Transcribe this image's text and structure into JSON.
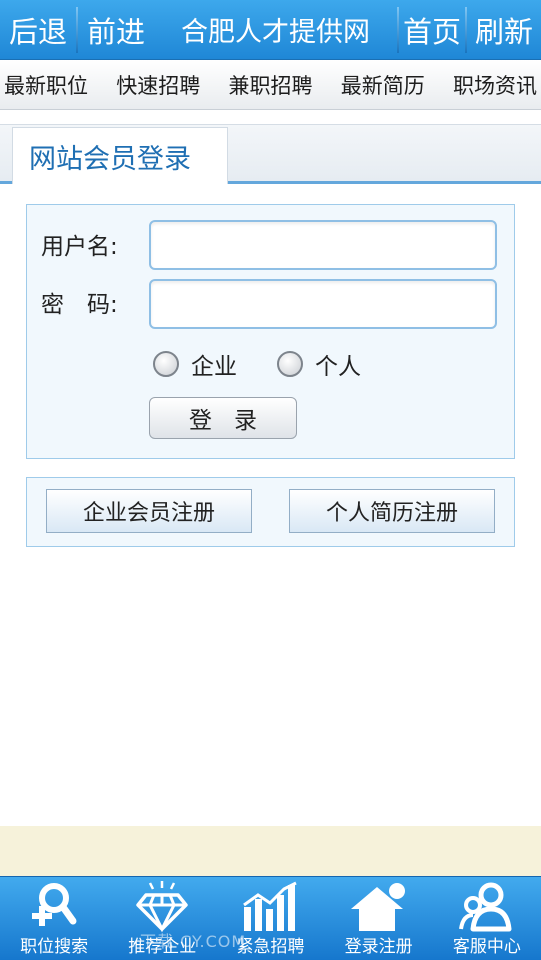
{
  "topbar": {
    "back_label": "后退",
    "forward_label": "前进",
    "title": "合肥人才提供网",
    "home_label": "首页",
    "refresh_label": "刷新"
  },
  "nav": {
    "items": [
      {
        "label": "最新职位"
      },
      {
        "label": "快速招聘"
      },
      {
        "label": "兼职招聘"
      },
      {
        "label": "最新简历"
      },
      {
        "label": "职场资讯"
      }
    ]
  },
  "tab": {
    "label": "网站会员登录"
  },
  "login": {
    "username_label": "用户名:",
    "password_label": "密　码:",
    "username_value": "",
    "password_value": "",
    "radio_enterprise": "企业",
    "radio_personal": "个人",
    "submit_label": "登录"
  },
  "register": {
    "enterprise_label": "企业会员注册",
    "personal_label": "个人简历注册"
  },
  "bottom": {
    "items": [
      {
        "label": "职位搜索",
        "icon": "person-search-icon"
      },
      {
        "label": "推荐企业",
        "icon": "diamond-icon"
      },
      {
        "label": "紧急招聘",
        "icon": "bar-chart-icon"
      },
      {
        "label": "登录注册",
        "icon": "house-icon"
      },
      {
        "label": "客服中心",
        "icon": "people-icon"
      }
    ],
    "watermark": "下载 CY.COM"
  },
  "colors": {
    "topbar": "#2a95e0",
    "bottombar": "#2a90e0",
    "tab_text": "#1f6fb3",
    "box_border": "#9fcbea",
    "beige": "#f6f2da"
  }
}
